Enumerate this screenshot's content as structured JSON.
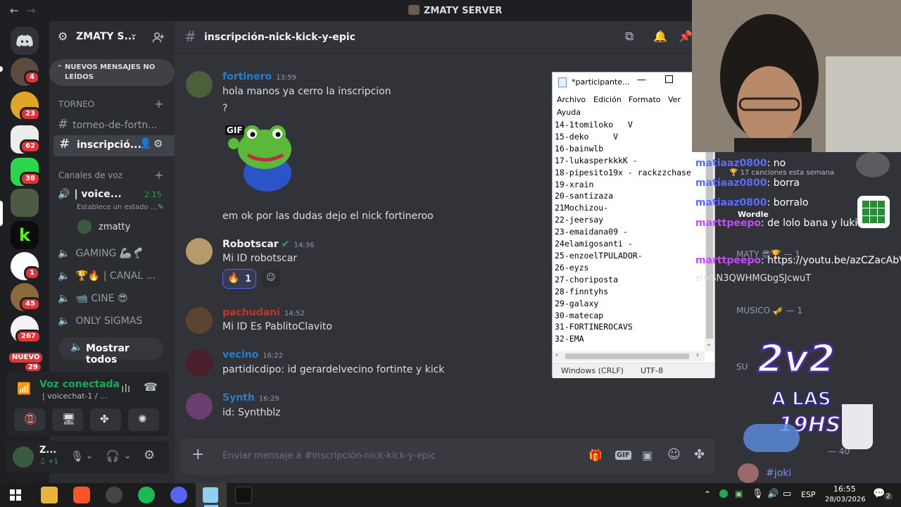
{
  "window": {
    "title": "ZMATY SERVER",
    "back": "←",
    "forward": "→"
  },
  "server": {
    "name": "ZMATY S...",
    "chevron": "⌄"
  },
  "unread_banner": "NUEVOS MENSAJES NO LEÍDOS",
  "sidebar": {
    "cat_torneo": "TORNEO",
    "channel1": "torneo-de-fortn...",
    "channel2": "inscripció...",
    "cat_voice": "Canales de voz",
    "voice1": "| voice...",
    "voice1_time": "2:15",
    "voice1_status": "Establece un estado ...",
    "voice_user": "zmatty",
    "voice2": "GAMING 🦾🦿",
    "voice3": "🏆🔥 | CANAL ...",
    "voice4": "📹 CINE 😎",
    "voice5": "ONLY SIGMAS",
    "show_all": "Mostrar todos"
  },
  "rail": {
    "badges": [
      "4",
      "23",
      "62",
      "38",
      "1",
      "45",
      "267"
    ],
    "nuevo": "NUEVO",
    "nuevo_count": "29"
  },
  "voice_panel": {
    "status": "Voz conectada",
    "channel": "| voicechat-1 / ..."
  },
  "user_panel": {
    "name": "Z...",
    "sub": "♫ +1"
  },
  "chat": {
    "channel": "inscripción-nick-kick-y-epic",
    "messages": [
      {
        "user": "fortinero",
        "time": "13:59",
        "lines": [
          "hola manos ya cerro la inscripcion",
          "?"
        ]
      },
      {
        "user": "",
        "time": "",
        "lines": [
          "em ok por las dudas dejo el nick fortineroo"
        ]
      },
      {
        "user": "Robotscar",
        "time": "14:36",
        "lines": [
          "Mi ID robotscar"
        ]
      },
      {
        "user": "pachudani",
        "time": "14:52",
        "lines": [
          "Mi ID Es PablitoClavito"
        ]
      },
      {
        "user": "vecino",
        "time": "16:22",
        "lines": [
          "partidicdipo: id gerardelvecino fortinte y kick"
        ]
      },
      {
        "user": "Synth",
        "time": "16:29",
        "lines": [
          "id: Synthblz"
        ]
      }
    ],
    "gif_label": "GIF",
    "reaction_count": "1",
    "composer_placeholder": "Enviar mensaje a #inscripción-nick-kick-y-epic"
  },
  "notepad": {
    "title": "*participante...",
    "menu": [
      "Archivo",
      "Edición",
      "Formato",
      "Ver",
      "Ayuda"
    ],
    "lines": [
      "14-1tomiloko   V",
      "15-deko     V",
      "16-bainwlb",
      "17-lukasperkkkK -",
      "18-pipesito19x - rackzzchase",
      "19-xrain",
      "20-santizaza",
      "21Mochizou-",
      "22-jeersay",
      "23-emaidana09 -",
      "24elamigosanti -",
      "25-enzoelTPULADOR-",
      "26-eyzs",
      "27-choriposta",
      "28-finntyhs",
      "29-galaxy",
      "30-matecap",
      "31-FORTINEROCAVS",
      "32-EMA"
    ],
    "encoding_eol": "Windows (CRLF)",
    "encoding": "UTF-8"
  },
  "overlay": {
    "chat_lines": [
      {
        "user": "matiaaz0800",
        "text": ": no"
      },
      {
        "user": "matiaaz0800",
        "text": ": borra"
      },
      {
        "user": "matiaaz0800",
        "text": ": borralo"
      },
      {
        "user": "marttpeepo",
        "text": ": de lolo bana y luki"
      },
      {
        "user": "marttpeepo",
        "text": ": https://youtu.be/azCZacAbVJk"
      }
    ],
    "link_tail": "si=SN3QWHMGbgSJcwuT",
    "songs": "17 canciones esta semana",
    "wordle": "Wordle",
    "maty": "MATY 😎🏆 — 1",
    "musico": "MUSICO 🎺 — 1",
    "sub": "SU",
    "sub_count": "— 40",
    "joki": "#joki",
    "promo_1": "2v2",
    "promo_2": "A LAS",
    "promo_3": "19HS"
  },
  "taskbar": {
    "lang": "ESP",
    "time": "16:55",
    "date": "28/03/2026",
    "notif": "2"
  }
}
